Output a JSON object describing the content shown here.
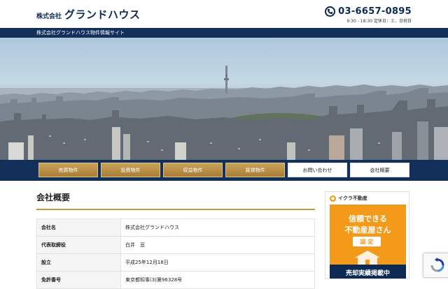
{
  "header": {
    "logo_prefix": "株式会社",
    "logo_name": "グランドハウス",
    "phone": "03-6657-0895",
    "hours": "9:30 - 18:30 定休日：土、日祝日"
  },
  "tagline": "株式会社グランドハウス物件情報サイト",
  "nav": {
    "items": [
      {
        "label": "売買物件"
      },
      {
        "label": "投資物件"
      },
      {
        "label": "収益物件"
      },
      {
        "label": "賃貸物件"
      },
      {
        "label": "お問い合わせ"
      },
      {
        "label": "会社概要"
      }
    ]
  },
  "main": {
    "title": "会社概要",
    "rows": [
      {
        "key": "会社名",
        "value": "株式会社グランドハウス"
      },
      {
        "key": "代表取締役",
        "value": "白井　亘"
      },
      {
        "key": "設立",
        "value": "平成25年12月18日"
      },
      {
        "key": "免許番号",
        "value": "東京都知事(3)第96328号"
      }
    ]
  },
  "banner": {
    "brand": "イクラ不動産",
    "line1": "信頼できる",
    "line2": "不動産屋さん",
    "badge": "認 定",
    "bottom": "売却実績掲載中"
  },
  "colors": {
    "navy": "#12305a",
    "gold": "#c9a25a",
    "accent_rule": "#c79a3f",
    "banner_orange": "#f39a1a"
  }
}
